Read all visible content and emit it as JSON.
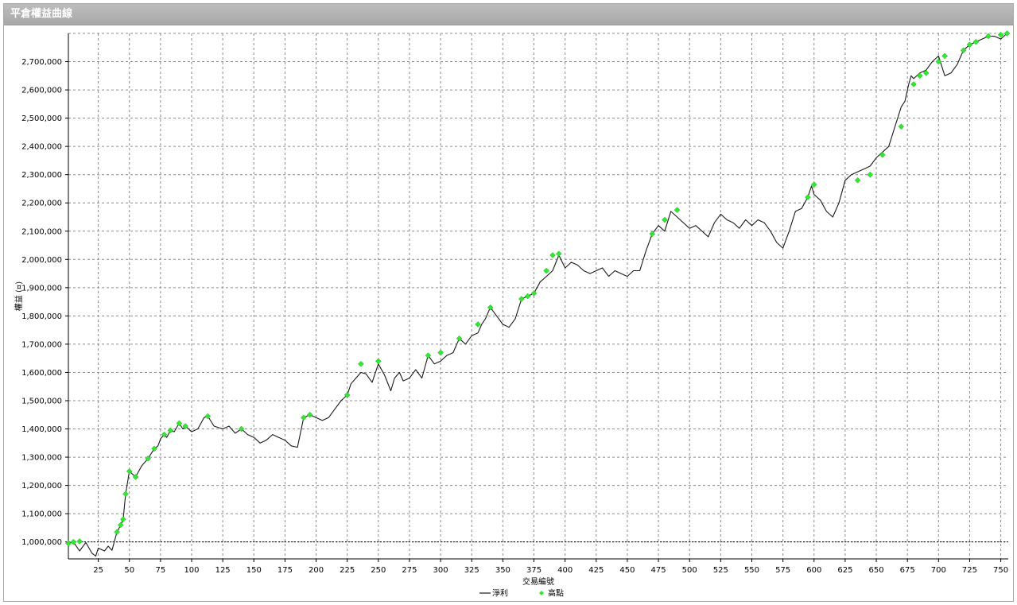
{
  "panel": {
    "title": "平倉權益曲線"
  },
  "chart_data": {
    "type": "line",
    "xlabel": "交易編號",
    "ylabel": "權益 (¤)",
    "xlim": [
      1,
      756
    ],
    "ylim": [
      940000,
      2800000
    ],
    "xticks": [
      25,
      50,
      75,
      100,
      125,
      150,
      175,
      200,
      225,
      250,
      275,
      300,
      325,
      350,
      375,
      400,
      425,
      450,
      475,
      500,
      525,
      550,
      575,
      600,
      625,
      650,
      675,
      700,
      725,
      750
    ],
    "yticks": [
      1000000,
      1100000,
      1200000,
      1300000,
      1400000,
      1500000,
      1600000,
      1700000,
      1800000,
      1900000,
      2000000,
      2100000,
      2200000,
      2300000,
      2400000,
      2500000,
      2600000,
      2700000
    ],
    "ytick_labels": [
      "1,000,000",
      "1,100,000",
      "1,200,000",
      "1,300,000",
      "1,400,000",
      "1,500,000",
      "1,600,000",
      "1,700,000",
      "1,800,000",
      "1,900,000",
      "2,000,000",
      "2,100,000",
      "2,200,000",
      "2,300,000",
      "2,400,000",
      "2,500,000",
      "2,600,000",
      "2,700,000"
    ],
    "grid": true,
    "reference_line": 1000000,
    "colors": {
      "line": "#1a1a1a",
      "marker": "#33e633",
      "grid": "#8c8c8c"
    },
    "legend": {
      "position": "bottom-center",
      "entries": [
        "淨利",
        "高點"
      ]
    },
    "series": [
      {
        "name": "淨利",
        "x": [
          1,
          5,
          10,
          15,
          20,
          23,
          25,
          30,
          33,
          36,
          40,
          43,
          45,
          47,
          50,
          55,
          60,
          65,
          70,
          73,
          75,
          78,
          80,
          83,
          86,
          90,
          93,
          95,
          100,
          105,
          110,
          113,
          118,
          125,
          130,
          135,
          140,
          145,
          150,
          155,
          160,
          165,
          170,
          175,
          180,
          185,
          190,
          195,
          200,
          205,
          210,
          215,
          220,
          225,
          228,
          232,
          236,
          240,
          245,
          250,
          255,
          260,
          263,
          267,
          270,
          275,
          280,
          285,
          290,
          295,
          300,
          305,
          310,
          315,
          320,
          325,
          330,
          333,
          336,
          340,
          345,
          350,
          355,
          360,
          365,
          370,
          375,
          380,
          385,
          390,
          395,
          400,
          405,
          410,
          415,
          420,
          425,
          430,
          435,
          440,
          445,
          450,
          455,
          460,
          465,
          470,
          475,
          480,
          485,
          490,
          495,
          500,
          505,
          510,
          515,
          520,
          525,
          530,
          535,
          540,
          545,
          550,
          555,
          560,
          565,
          570,
          575,
          580,
          585,
          590,
          595,
          598,
          600,
          605,
          610,
          615,
          620,
          625,
          630,
          635,
          640,
          645,
          650,
          655,
          660,
          665,
          670,
          673,
          676,
          678,
          680,
          685,
          690,
          695,
          700,
          705,
          710,
          715,
          720,
          725,
          730,
          735,
          740,
          745,
          750,
          755
        ],
        "y": [
          995000,
          1000000,
          968000,
          998000,
          960000,
          950000,
          978000,
          968000,
          985000,
          970000,
          1035000,
          1060000,
          1080000,
          1170000,
          1250000,
          1230000,
          1270000,
          1295000,
          1330000,
          1340000,
          1365000,
          1380000,
          1370000,
          1395000,
          1390000,
          1420000,
          1400000,
          1410000,
          1390000,
          1400000,
          1440000,
          1445000,
          1410000,
          1400000,
          1410000,
          1385000,
          1400000,
          1380000,
          1370000,
          1350000,
          1360000,
          1380000,
          1370000,
          1360000,
          1340000,
          1335000,
          1440000,
          1450000,
          1440000,
          1430000,
          1440000,
          1470000,
          1500000,
          1520000,
          1560000,
          1580000,
          1600000,
          1595000,
          1565000,
          1630000,
          1590000,
          1535000,
          1580000,
          1600000,
          1570000,
          1580000,
          1610000,
          1580000,
          1660000,
          1630000,
          1640000,
          1660000,
          1670000,
          1720000,
          1700000,
          1730000,
          1740000,
          1770000,
          1790000,
          1830000,
          1800000,
          1770000,
          1760000,
          1790000,
          1860000,
          1870000,
          1880000,
          1920000,
          1940000,
          1960000,
          2015000,
          1970000,
          1990000,
          1980000,
          1960000,
          1950000,
          1960000,
          1970000,
          1940000,
          1960000,
          1950000,
          1940000,
          1960000,
          1960000,
          2030000,
          2090000,
          2120000,
          2100000,
          2170000,
          2150000,
          2130000,
          2110000,
          2120000,
          2100000,
          2080000,
          2130000,
          2160000,
          2140000,
          2130000,
          2110000,
          2140000,
          2120000,
          2140000,
          2130000,
          2100000,
          2060000,
          2040000,
          2100000,
          2170000,
          2180000,
          2220000,
          2260000,
          2230000,
          2210000,
          2170000,
          2150000,
          2200000,
          2280000,
          2300000,
          2310000,
          2320000,
          2330000,
          2360000,
          2380000,
          2400000,
          2470000,
          2540000,
          2560000,
          2620000,
          2650000,
          2640000,
          2660000,
          2670000,
          2700000,
          2720000,
          2650000,
          2660000,
          2690000,
          2740000,
          2760000,
          2770000,
          2780000,
          2790000,
          2790000,
          2780000,
          2800000
        ],
        "style": "line"
      },
      {
        "name": "高點",
        "x": [
          1,
          5,
          10,
          40,
          43,
          45,
          47,
          50,
          55,
          65,
          70,
          78,
          83,
          90,
          95,
          113,
          140,
          190,
          195,
          225,
          236,
          250,
          290,
          300,
          315,
          330,
          340,
          365,
          370,
          375,
          385,
          390,
          395,
          470,
          480,
          490,
          595,
          600,
          635,
          645,
          655,
          670,
          680,
          685,
          690,
          700,
          705,
          720,
          725,
          730,
          740,
          750,
          755
        ],
        "y": [
          995000,
          1000000,
          1002000,
          1035000,
          1060000,
          1080000,
          1170000,
          1250000,
          1230000,
          1295000,
          1330000,
          1380000,
          1395000,
          1420000,
          1410000,
          1445000,
          1400000,
          1440000,
          1450000,
          1520000,
          1630000,
          1640000,
          1660000,
          1670000,
          1720000,
          1770000,
          1830000,
          1860000,
          1870000,
          1880000,
          1960000,
          2015000,
          2020000,
          2090000,
          2140000,
          2175000,
          2220000,
          2265000,
          2280000,
          2300000,
          2370000,
          2470000,
          2620000,
          2650000,
          2660000,
          2700000,
          2720000,
          2740000,
          2760000,
          2770000,
          2790000,
          2795000,
          2800000
        ],
        "style": "markers"
      }
    ]
  }
}
